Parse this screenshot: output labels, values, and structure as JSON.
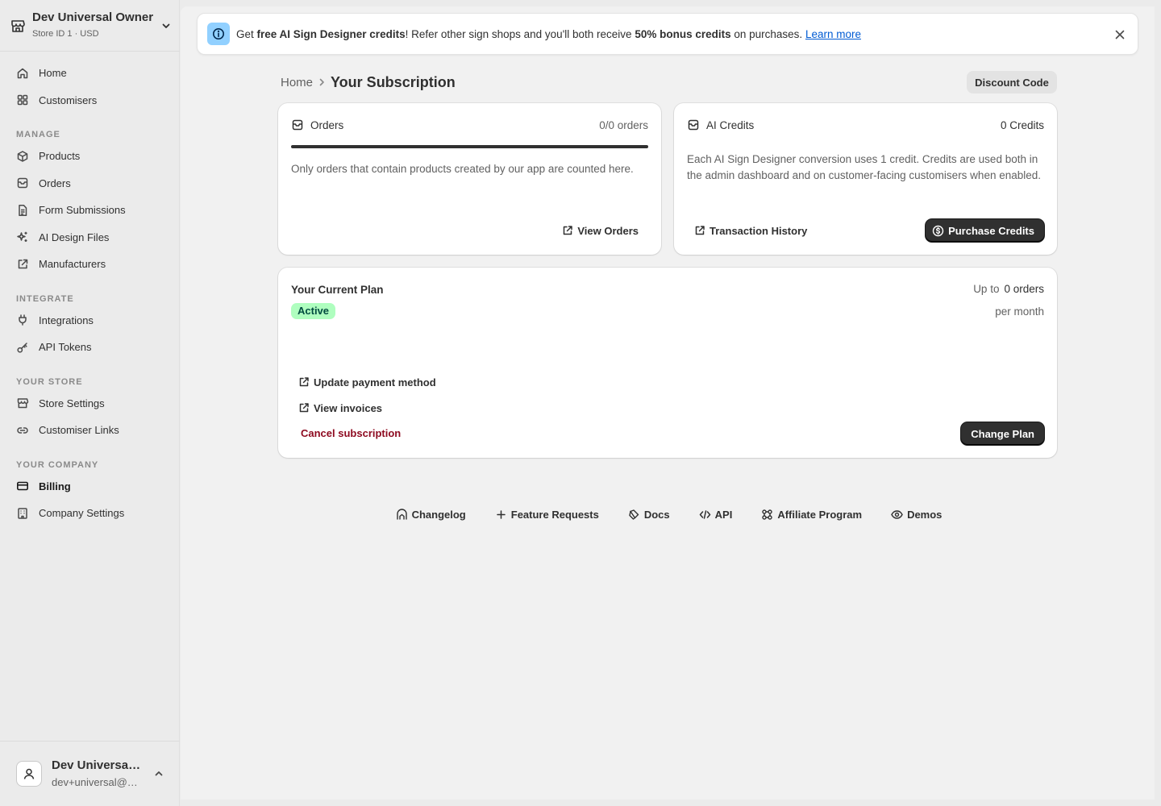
{
  "store": {
    "name": "Dev Universal Owner",
    "subtitle": "Store ID 1 · USD"
  },
  "nav": {
    "top": [
      {
        "label": "Home",
        "icon": "home-icon"
      },
      {
        "label": "Customisers",
        "icon": "grid-icon"
      }
    ],
    "manage_label": "MANAGE",
    "manage": [
      {
        "label": "Products",
        "icon": "product-icon"
      },
      {
        "label": "Orders",
        "icon": "order-icon"
      },
      {
        "label": "Form Submissions",
        "icon": "form-icon"
      },
      {
        "label": "AI Design Files",
        "icon": "sparkle-icon"
      },
      {
        "label": "Manufacturers",
        "icon": "external-icon"
      }
    ],
    "integrate_label": "INTEGRATE",
    "integrate": [
      {
        "label": "Integrations",
        "icon": "plug-icon"
      },
      {
        "label": "API Tokens",
        "icon": "key-icon"
      }
    ],
    "store_label": "YOUR STORE",
    "store": [
      {
        "label": "Store Settings",
        "icon": "store-icon"
      },
      {
        "label": "Customiser Links",
        "icon": "link-icon"
      }
    ],
    "company_label": "YOUR COMPANY",
    "company": [
      {
        "label": "Billing",
        "icon": "card-icon"
      },
      {
        "label": "Company Settings",
        "icon": "building-icon"
      }
    ]
  },
  "user": {
    "name": "Dev Universal Owner",
    "email": "dev+universal@example.com"
  },
  "banner": {
    "t1": "Get ",
    "b1": "free AI Sign Designer credits",
    "t2": "! Refer other sign shops and you'll both receive ",
    "b2": "50% bonus credits",
    "t3": " on purchases. ",
    "link": "Learn more"
  },
  "header": {
    "breadcrumb_home": "Home",
    "title": "Your Subscription",
    "discount_button": "Discount Code"
  },
  "orders_card": {
    "title": "Orders",
    "count": "0/0 orders",
    "progress": 1.0,
    "description": "Only orders that contain products created by our app are counted here.",
    "view_button": "View Orders"
  },
  "credits_card": {
    "title": "AI Credits",
    "count": "0 Credits",
    "description": "Each AI Sign Designer conversion uses 1 credit. Credits are used both in the admin dashboard and on customer-facing customisers when enabled.",
    "history_button": "Transaction History",
    "purchase_button": "Purchase Credits"
  },
  "plan_card": {
    "title": "Your Current Plan",
    "status": "Active",
    "limit_prefix": "Up to",
    "limit_value": "0 orders",
    "limit_period": "per month",
    "update_payment": "Update payment method",
    "view_invoices": "View invoices",
    "cancel": "Cancel subscription",
    "change_plan": "Change Plan"
  },
  "footer": [
    {
      "label": "Changelog",
      "icon": "changelog-icon"
    },
    {
      "label": "Feature Requests",
      "icon": "plus-icon"
    },
    {
      "label": "Docs",
      "icon": "docs-icon"
    },
    {
      "label": "API",
      "icon": "code-icon"
    },
    {
      "label": "Affiliate Program",
      "icon": "affiliate-icon"
    },
    {
      "label": "Demos",
      "icon": "eye-icon"
    }
  ],
  "colors": {
    "accent_dark": "#303030",
    "link": "#005bd3",
    "badge_bg": "#affebf",
    "danger": "#8e0b21",
    "info": "#91d0ff"
  }
}
